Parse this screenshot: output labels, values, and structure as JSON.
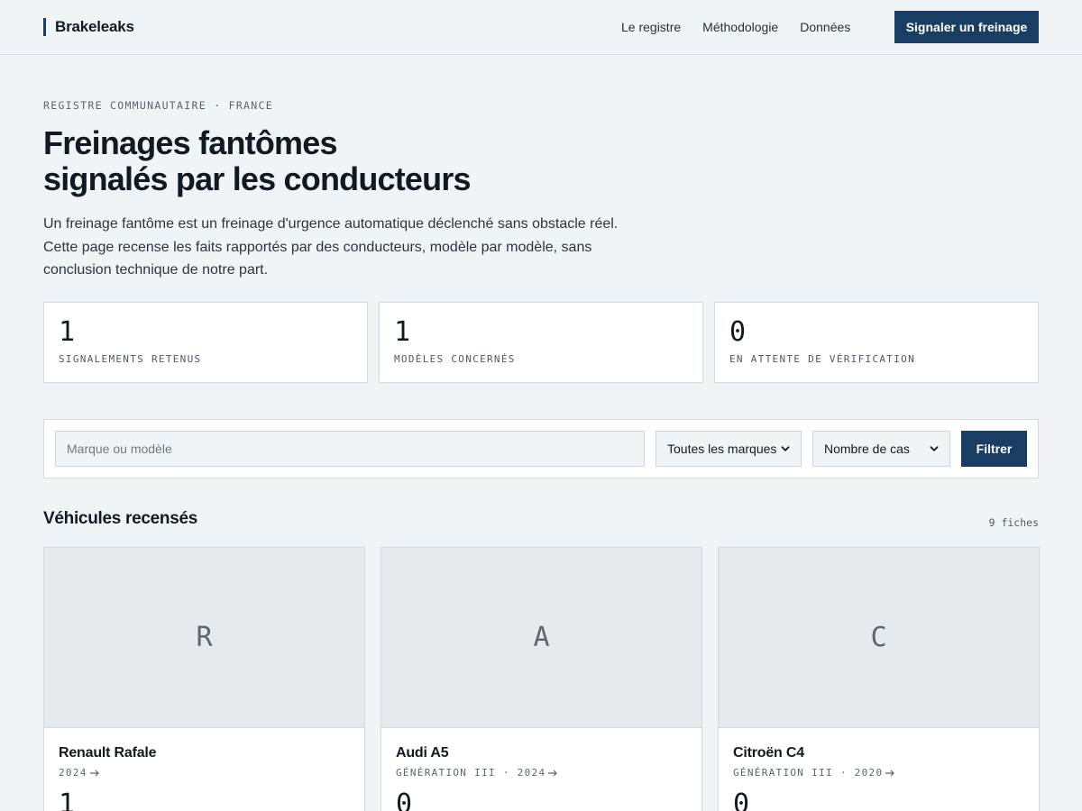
{
  "header": {
    "brand": "Brakeleaks",
    "nav": [
      "Le registre",
      "Méthodologie",
      "Données"
    ],
    "cta": "Signaler un freinage"
  },
  "hero": {
    "kicker": "REGISTRE COMMUNAUTAIRE · FRANCE",
    "title_line1": "Freinages fantômes",
    "title_line2": "signalés par les conducteurs",
    "lead_line1": "Un freinage fantôme est un freinage d'urgence automatique déclenché sans obstacle réel.",
    "lead_line2": "Cette page recense les faits rapportés par des conducteurs, modèle par modèle, sans",
    "lead_line3": "conclusion technique de notre part."
  },
  "stats": [
    {
      "value": "1",
      "label": "SIGNALEMENTS RETENUS"
    },
    {
      "value": "1",
      "label": "MODÈLES CONCERNÉS"
    },
    {
      "value": "0",
      "label": "EN ATTENTE DE VÉRIFICATION"
    }
  ],
  "filters": {
    "search_placeholder": "Marque ou modèle",
    "brand_select": "Toutes les marques",
    "sort_select": "Nombre de cas",
    "submit": "Filtrer"
  },
  "section": {
    "title": "Véhicules recensés",
    "count": "9 fiches"
  },
  "cards": [
    {
      "initial": "R",
      "name": "Renault Rafale",
      "meta": "2024",
      "count": "1"
    },
    {
      "initial": "A",
      "name": "Audi A5",
      "meta": "GÉNÉRATION III · 2024",
      "count": "0"
    },
    {
      "initial": "C",
      "name": "Citroën C4",
      "meta": "GÉNÉRATION III · 2020",
      "count": "0"
    }
  ],
  "colors": {
    "accent": "#1a3e63",
    "background": "#f1f4f6"
  }
}
